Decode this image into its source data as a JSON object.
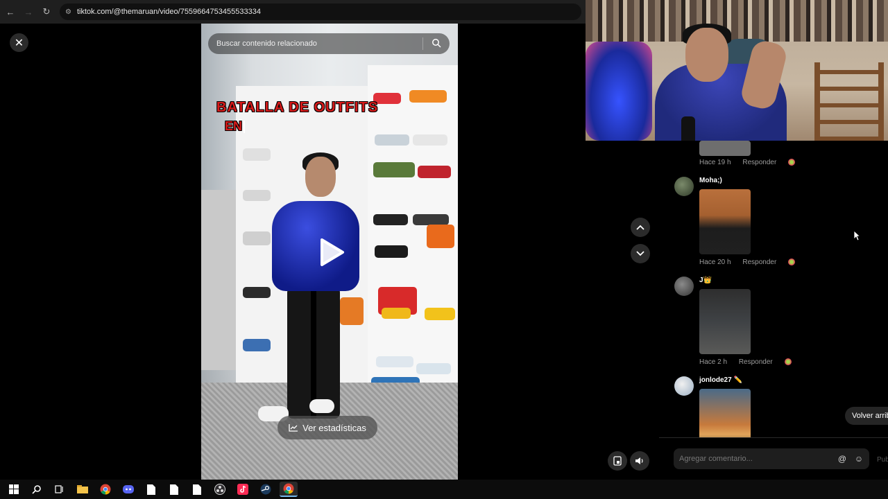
{
  "browser": {
    "url": "tiktok.com/@themaruan/video/7559664753455533334"
  },
  "video": {
    "search_placeholder": "Buscar contenido relacionado",
    "overlay_line1": "BATALLA DE OUTFITS",
    "overlay_line2": "EN",
    "stats_button": "Ver estadísticas"
  },
  "comments": [
    {
      "user": "",
      "time": "Hace 19 h",
      "reply": "Responder"
    },
    {
      "user": "Moha;)",
      "time": "Hace 20 h",
      "reply": "Responder"
    },
    {
      "user": "J👑",
      "time": "Hace 2 h",
      "reply": "Responder"
    },
    {
      "user": "jonlode27 ✏️",
      "time": "",
      "reply": ""
    }
  ],
  "back_to_top": "Volver arriba",
  "comment_box": {
    "placeholder": "Agregar comentario...",
    "publish": "Publicar"
  },
  "colors": {
    "overlay_text": "#d81b1b",
    "taskbar_active": "#76b9ed"
  },
  "taskbar_icons": [
    "windows-start-icon",
    "search-icon",
    "task-view-icon",
    "file-explorer-icon",
    "chrome-icon",
    "discord-icon",
    "file-icon",
    "file-icon",
    "file-icon",
    "obs-icon",
    "tiktok-icon",
    "steam-icon",
    "chrome-icon"
  ]
}
